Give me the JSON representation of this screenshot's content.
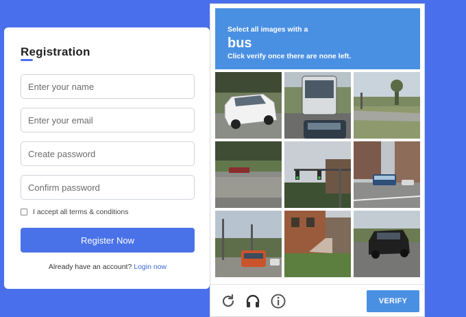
{
  "registration": {
    "title": "Registration",
    "fields": {
      "name_placeholder": "Enter your name",
      "email_placeholder": "Enter your email",
      "password_placeholder": "Create password",
      "confirm_placeholder": "Confirm password"
    },
    "terms_label": "I accept all terms & conditions",
    "register_label": "Register Now",
    "login_prompt": "Already have an account?",
    "login_link": "Login now"
  },
  "captcha": {
    "instruction_line1": "Select all images with a",
    "target": "bus",
    "instruction_line3": "Click verify once there are none left.",
    "tiles": [
      "white van on street",
      "bus front on road",
      "empty parking lot",
      "highway barrier wall",
      "traffic light pole",
      "bus on city street",
      "bus at station",
      "house with stairs",
      "black suv on road"
    ],
    "verify_label": "VERIFY",
    "icons": [
      "reload-icon",
      "audio-icon",
      "info-icon"
    ]
  },
  "colors": {
    "background": "#4a6fec",
    "captcha_accent": "#4a90e2",
    "register_button": "#4a72e8"
  }
}
